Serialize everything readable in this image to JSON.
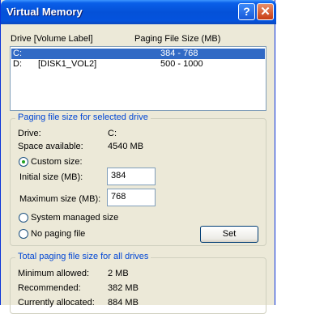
{
  "window": {
    "title": "Virtual Memory",
    "help_glyph": "?",
    "close_glyph": "✕"
  },
  "list": {
    "headers": {
      "drive": "Drive  [Volume Label]",
      "size": "Paging File Size (MB)"
    },
    "rows": [
      {
        "drive": "C:",
        "label": "",
        "size": "384 - 768",
        "selected": true
      },
      {
        "drive": "D:",
        "label": "[DISK1_VOL2]",
        "size": "500 - 1000",
        "selected": false
      }
    ]
  },
  "selected_drive": {
    "title": "Paging file size for selected drive",
    "drive_label": "Drive:",
    "drive_value": "C:",
    "space_label": "Space available:",
    "space_value": "4540 MB",
    "custom_label": "Custom size:",
    "initial_label": "Initial size (MB):",
    "initial_value": "384",
    "maximum_label": "Maximum size (MB):",
    "maximum_value": "768",
    "system_label": "System managed size",
    "nopaging_label": "No paging file",
    "set_label": "Set",
    "selected_option": "custom"
  },
  "totals": {
    "title": "Total paging file size for all drives",
    "min_label": "Minimum allowed:",
    "min_value": "2 MB",
    "rec_label": "Recommended:",
    "rec_value": "382 MB",
    "cur_label": "Currently allocated:",
    "cur_value": "884 MB"
  },
  "colors": {
    "titlebar": "#0451d8",
    "selection": "#316ac5",
    "group_title": "#0046d5",
    "face": "#ece9d8"
  }
}
